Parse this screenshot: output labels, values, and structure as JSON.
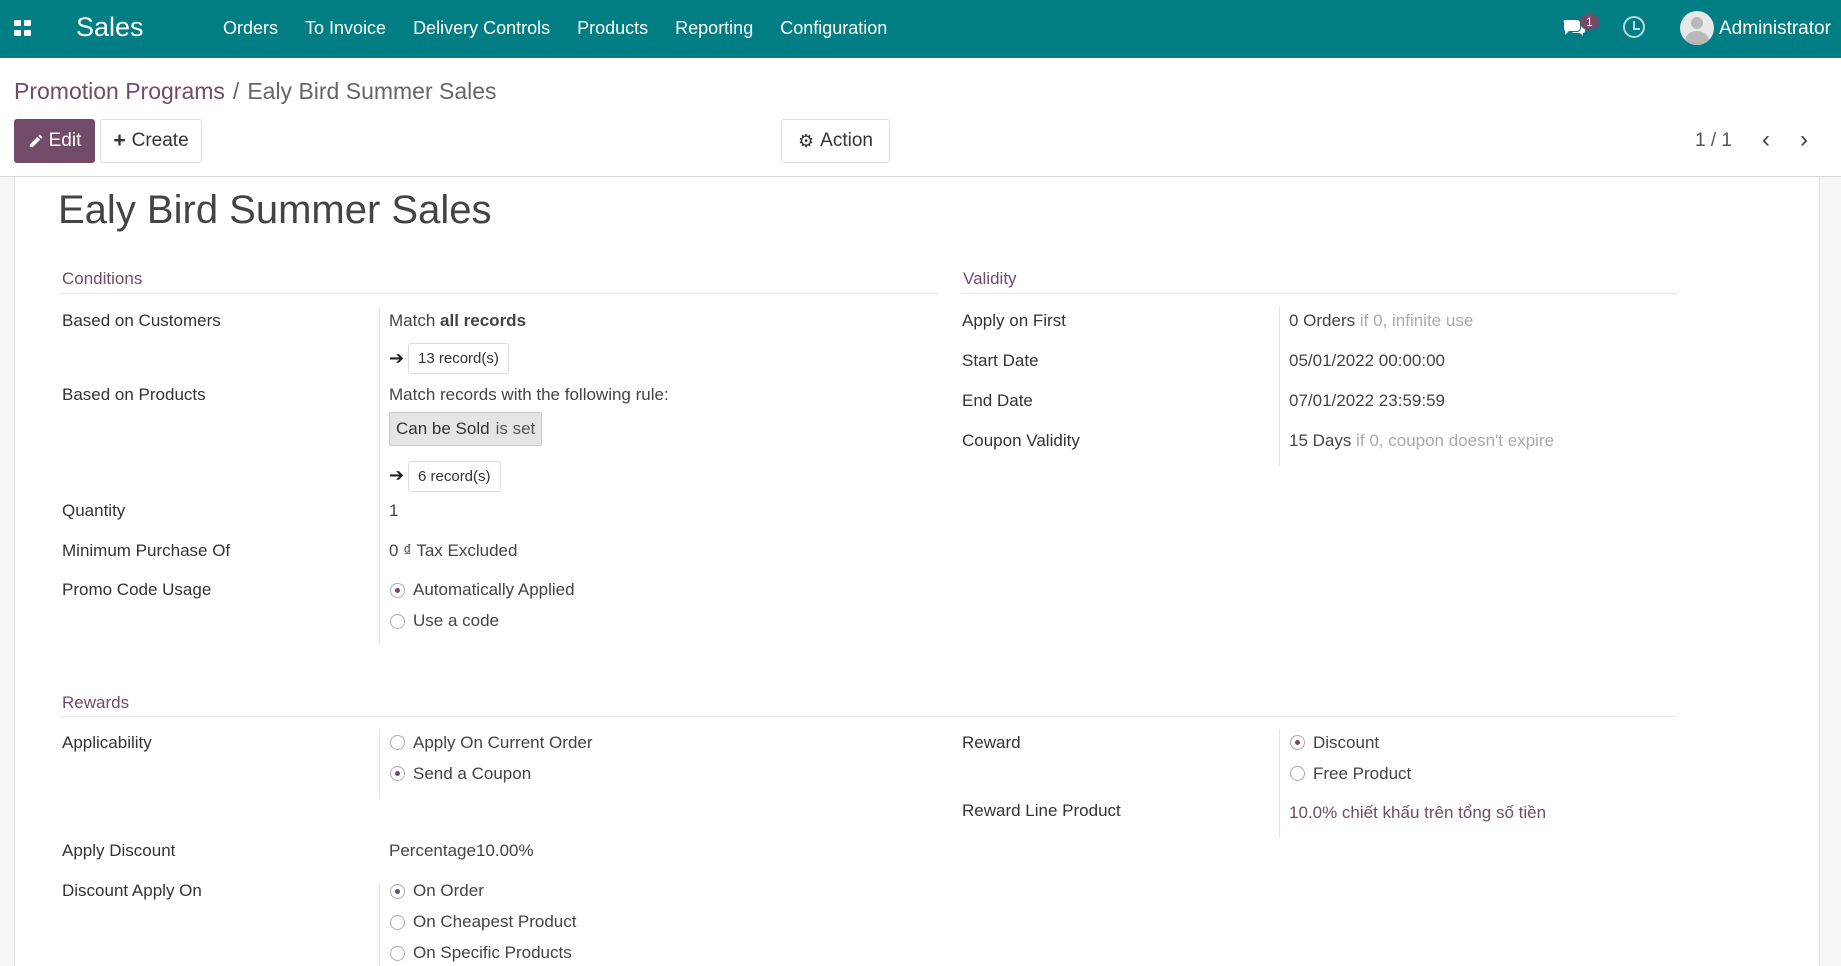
{
  "nav": {
    "app_name": "Sales",
    "menu": [
      "Orders",
      "To Invoice",
      "Delivery Controls",
      "Products",
      "Reporting",
      "Configuration"
    ],
    "chat_count": "1",
    "user": "Administrator"
  },
  "breadcrumb": {
    "parent": "Promotion Programs",
    "separator": "/",
    "current": "Ealy Bird Summer Sales"
  },
  "buttons": {
    "edit": "Edit",
    "create": "Create",
    "action": "Action"
  },
  "pager": {
    "value": "1 / 1"
  },
  "record": {
    "title": "Ealy Bird Summer Sales",
    "conditions": {
      "heading": "Conditions",
      "customers_label": "Based on Customers",
      "customers_match_prefix": "Match ",
      "customers_match_bold": "all records",
      "customers_records": "13 record(s)",
      "products_label": "Based on Products",
      "products_match": "Match records with the following rule:",
      "products_rule_field": "Can be Sold",
      "products_rule_op": "is set",
      "products_records": "6 record(s)",
      "quantity_label": "Quantity",
      "quantity": "1",
      "min_purchase_label": "Minimum Purchase Of",
      "min_purchase": "0 ₫",
      "min_purchase_tax": "Tax Excluded",
      "promo_usage_label": "Promo Code Usage",
      "promo_usage_options": [
        "Automatically Applied",
        "Use a code"
      ]
    },
    "validity": {
      "heading": "Validity",
      "apply_first_label": "Apply on First",
      "apply_first": "0 Orders",
      "apply_first_hint": "if 0, infinite use",
      "start_label": "Start Date",
      "start": "05/01/2022 00:00:00",
      "end_label": "End Date",
      "end": "07/01/2022 23:59:59",
      "coupon_label": "Coupon Validity",
      "coupon": "15 Days",
      "coupon_hint": "if 0, coupon doesn't expire"
    },
    "rewards": {
      "heading": "Rewards",
      "applicability_label": "Applicability",
      "applicability_options": [
        "Apply On Current Order",
        "Send a Coupon"
      ],
      "reward_label": "Reward",
      "reward_options": [
        "Discount",
        "Free Product"
      ],
      "reward_line_label": "Reward Line Product",
      "reward_line": "10.0% chiết khấu trên tổng số tiền",
      "apply_discount_label": "Apply Discount",
      "apply_discount": "Percentage10.00%",
      "discount_on_label": "Discount Apply On",
      "discount_on_options": [
        "On Order",
        "On Cheapest Product",
        "On Specific Products"
      ]
    }
  },
  "colors": {
    "navbar": "#017e84",
    "accent": "#714b67"
  }
}
